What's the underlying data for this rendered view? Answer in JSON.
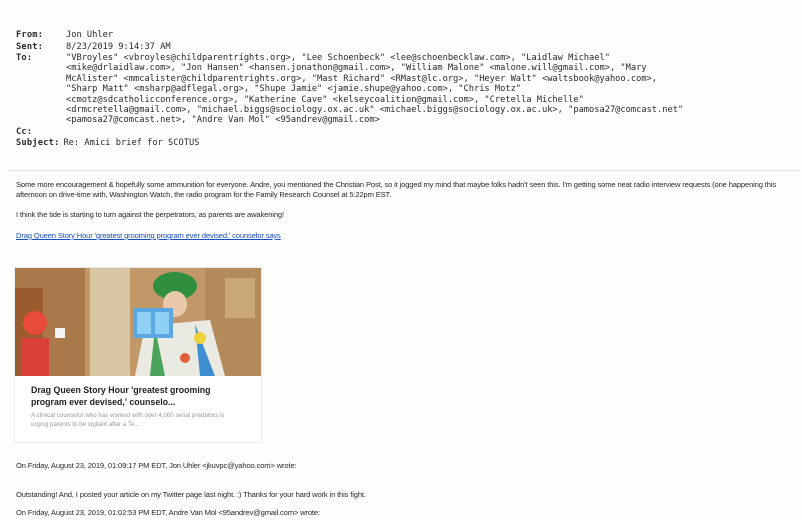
{
  "header": {
    "from_label": "From:",
    "from": "Jon Uhler",
    "sent_label": "Sent:",
    "sent": "8/23/2019 9:14:37 AM",
    "to_label": "To:",
    "to": "\"VBroyles\" <vbroyles@childparentrights.org>, \"Lee Schoenbeck\" <lee@schoenbecklaw.com>, \"Laidlaw Michael\"\n<mike@drlaidlaw.com>, \"Jon Hansen\" <hansen.jonathon@gmail.com>, \"William Malone\" <malone.will@gmail.com>, \"Mary\nMcAlister\" <mmcalister@childparentrights.org>, \"Mast Richard\" <RMast@lc.org>, \"Heyer Walt\" <waltsbook@yahoo.com>,\n\"Sharp Matt\" <msharp@adflegal.org>, \"Shupe Jamie\" <jamie.shupe@yahoo.com>, \"Chris Motz\"\n<cmotz@sdcatholicconference.org>, \"Katherine Cave\" <kelseycoalition@gmail.com>, \"Cretella Michelle\"\n<drmcretella@gmail.com>, \"michael.biggs@sociology.ox.ac.uk\" <michael.biggs@sociology.ox.ac.uk>, \"pamosa27@comcast.net\"\n<pamosa27@comcast.net>, \"Andre Van Mol\" <95andrev@gmail.com>",
    "cc_label": "Cc:",
    "cc": "",
    "subject_label": "Subject:",
    "subject": "Re: Amici brief for SCOTUS"
  },
  "body": {
    "para1": "Some more encouragement & hopefully some ammunition for everyone. Andre, you mentioned the Christian Post, so it jogged my mind that maybe folks hadn't seen this. I'm getting some neat radio interview requests (one happening this afternoon on drive-time with, Washington Watch, the radio program for the Family Research Counsel at 5:22pm EST.",
    "para2": "I think the tide is starting to turn against the perpetrators, as parents are awakening!",
    "link": "Drag Queen Story Hour 'greatest grooming program ever devised,' counselor says"
  },
  "card": {
    "title": "Drag Queen Story Hour 'greatest grooming program ever devised,' counselo...",
    "snippet": "A clinical counselor who has worked with over 4,000 serial predators is urging parents to be vigilant after a Te..."
  },
  "thread": {
    "line1": "On Friday, August 23, 2019, 01:09:17 PM EDT, Jon Uhler <jkuvpc@yahoo.com> wrote:",
    "line2": "Outstanding!  And, I posted your article on my Twitter page last night.  :)  Thanks for your hard work in this fight.",
    "line3": "On Friday, August 23, 2019, 01:02:53 PM EDT, Andre Van Mol <95andrev@gmail.com> wrote:"
  }
}
